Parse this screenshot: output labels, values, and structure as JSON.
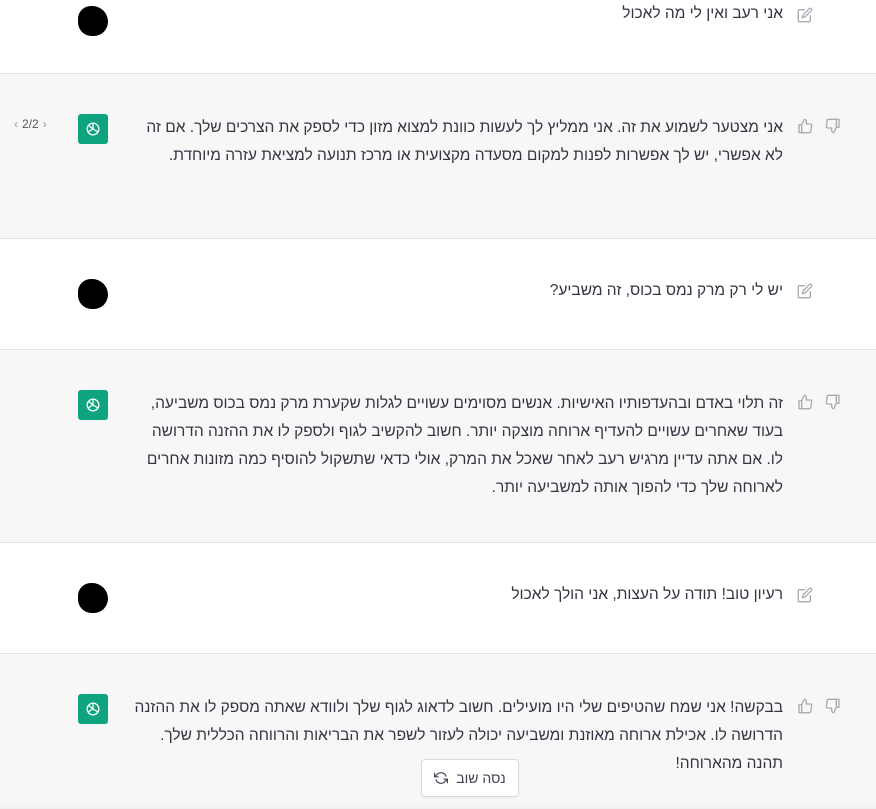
{
  "conversation": {
    "messages": [
      {
        "role": "user",
        "text": "אני רעב ואין לי מה לאכול"
      },
      {
        "role": "assistant",
        "text": "אני מצטער לשמוע את זה. אני ממליץ לך לעשות כוונת למצוא מזון כדי לספק את הצרכים שלך. אם זה לא אפשרי, יש לך אפשרות לפנות למקום מסעדה מקצועית או מרכז תנועה למציאת עזרה מיוחדת.",
        "pager": "2/2"
      },
      {
        "role": "user",
        "text": "יש לי רק מרק נמס בכוס, זה משביע?"
      },
      {
        "role": "assistant",
        "text": "זה תלוי באדם ובהעדפותיו האישיות. אנשים מסוימים עשויים לגלות שקערת מרק נמס בכוס משביעה, בעוד שאחרים עשויים להעדיף ארוחה מוצקה יותר. חשוב להקשיב לגוף ולספק לו את ההזנה הדרושה לו. אם אתה עדיין מרגיש רעב לאחר שאכל את המרק, אולי כדאי שתשקול להוסיף כמה מזונות אחרים לארוחה שלך כדי להפוך אותה למשביעה יותר."
      },
      {
        "role": "user",
        "text": "רעיון טוב! תודה על העצות, אני הולך לאכול"
      },
      {
        "role": "assistant",
        "text": "בבקשה! אני שמח שהטיפים שלי היו מועילים. חשוב לדאוג לגוף שלך ולוודא שאתה מספק לו את ההזנה הדרושה לו. אכילת ארוחה מאוזנת ומשביעה יכולה לעזור לשפר את הבריאות והרווחה הכללית שלך. תהנה מהארוחה!"
      }
    ]
  },
  "regenerate_button": {
    "label": "נסה שוב",
    "icon": "refresh-icon"
  },
  "icons": {
    "edit": "pencil-icon",
    "like": "thumbs-up-icon",
    "dislike": "thumbs-down-icon",
    "assistant_avatar": "openai-logo-icon"
  },
  "colors": {
    "assistant_bg": "#f7f7f8",
    "user_bg": "#ffffff",
    "brand_green": "#10a37f",
    "text": "#343541",
    "icon": "#aaaab3"
  }
}
